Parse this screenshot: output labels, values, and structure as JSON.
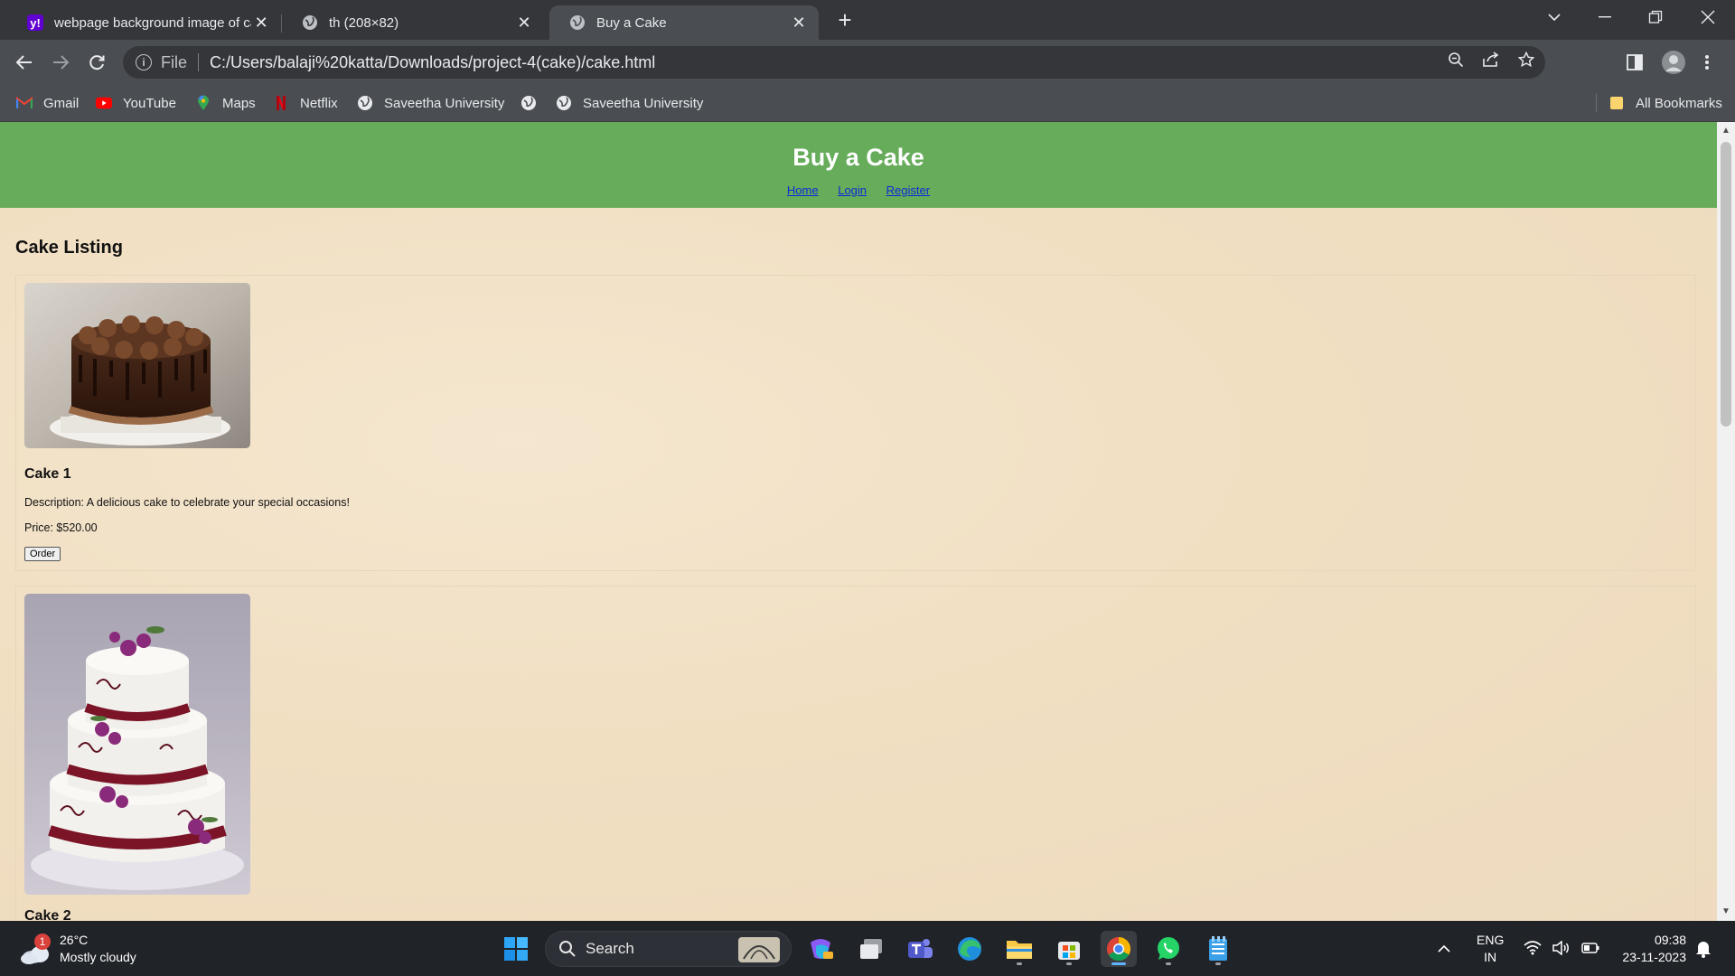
{
  "browser": {
    "tabs": [
      {
        "title": "webpage background image of cake",
        "favicon": "yahoo-icon"
      },
      {
        "title": "th (208×82)",
        "favicon": "globe-icon"
      },
      {
        "title": "Buy a Cake",
        "favicon": "globe-icon",
        "active": true
      }
    ],
    "address": {
      "scheme_label": "File",
      "url": "C:/Users/balaji%20katta/Downloads/project-4(cake)/cake.html"
    },
    "bookmarks": [
      {
        "label": "Gmail",
        "icon": "gmail-icon"
      },
      {
        "label": "YouTube",
        "icon": "youtube-icon"
      },
      {
        "label": "Maps",
        "icon": "maps-icon"
      },
      {
        "label": "Netflix",
        "icon": "netflix-icon"
      },
      {
        "label": "Saveetha University",
        "icon": "globe-icon"
      },
      {
        "label": "",
        "icon": "globe-icon"
      },
      {
        "label": "Saveetha University",
        "icon": "globe-icon"
      }
    ],
    "all_bookmarks_label": "All Bookmarks"
  },
  "site": {
    "title": "Buy a Cake",
    "nav": [
      "Home",
      "Login",
      "Register"
    ],
    "section_title": "Cake Listing",
    "cakes": [
      {
        "name": "Cake 1",
        "description": "Description: A delicious cake to celebrate your special occasions!",
        "price": "Price: $520.00",
        "order_label": "Order",
        "image": "chocolate-drip-cake-photo"
      },
      {
        "name": "Cake 2",
        "image": "white-tiered-wedding-cake-photo"
      }
    ]
  },
  "taskbar": {
    "weather": {
      "temp": "26°C",
      "condition": "Mostly cloudy",
      "badge": "1"
    },
    "search_placeholder": "Search",
    "language": {
      "line1": "ENG",
      "line2": "IN"
    },
    "time": "09:38",
    "date": "23-11-2023"
  },
  "colors": {
    "header_green": "#66ac5b",
    "page_background": "#f1dfc2",
    "link_blue": "#0b2bd6",
    "chrome_dark": "#35363a",
    "chrome_toolbar": "#4a4d52"
  }
}
